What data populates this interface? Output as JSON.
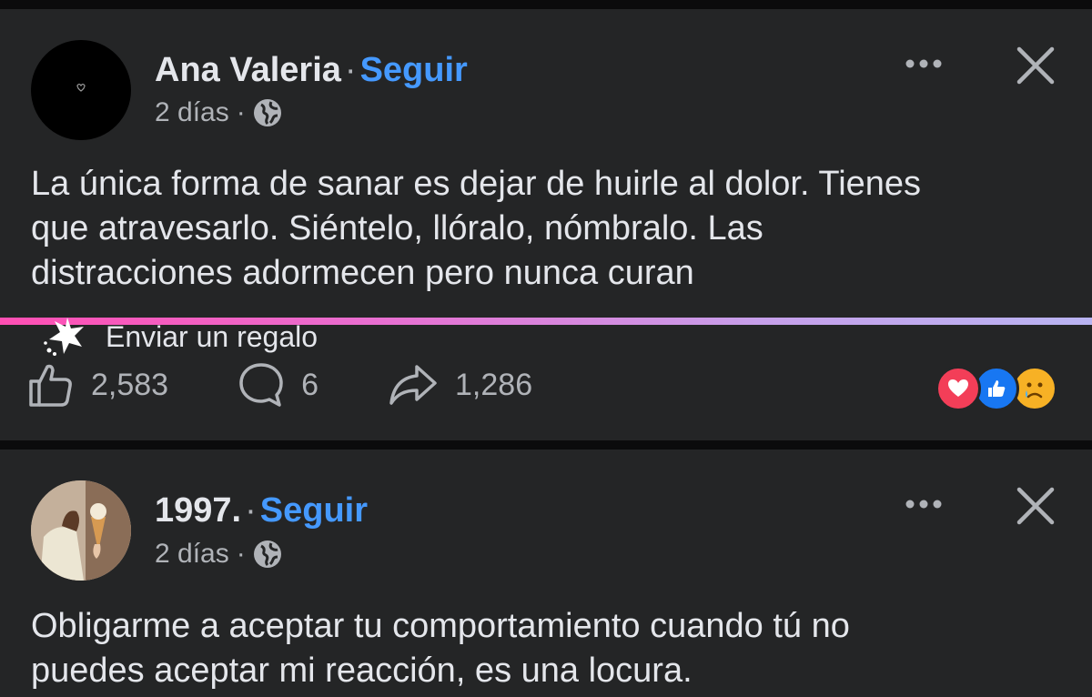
{
  "posts": [
    {
      "author": "Ana Valeria",
      "separator": "·",
      "follow_label": "Seguir",
      "time": "2 días",
      "time_sep": "·",
      "privacy_icon": "globe-icon",
      "text": "La única forma de sanar es dejar de huirle al dolor. Tienes\nque atravesarlo. Siéntelo, llóralo, nómbralo. Las\ndistracciones adormecen pero nunca curan",
      "gift_label": "Enviar un regalo",
      "likes": "2,583",
      "comments": "6",
      "shares": "1,286",
      "reactions": [
        "love",
        "like",
        "sad"
      ]
    },
    {
      "author": "1997.",
      "separator": "·",
      "follow_label": "Seguir",
      "time": "2 días",
      "time_sep": "·",
      "privacy_icon": "globe-icon",
      "text": "Obligarme a aceptar tu comportamiento cuando tú no\npuedes aceptar mi reacción, es una locura."
    }
  ],
  "colors": {
    "background": "#0b0b0c",
    "card": "#242526",
    "text": "#e4e6eb",
    "secondary": "#b0b3b8",
    "link": "#4599ff",
    "love": "#f33e58",
    "like": "#1877f2",
    "sad": "#f7b125"
  }
}
